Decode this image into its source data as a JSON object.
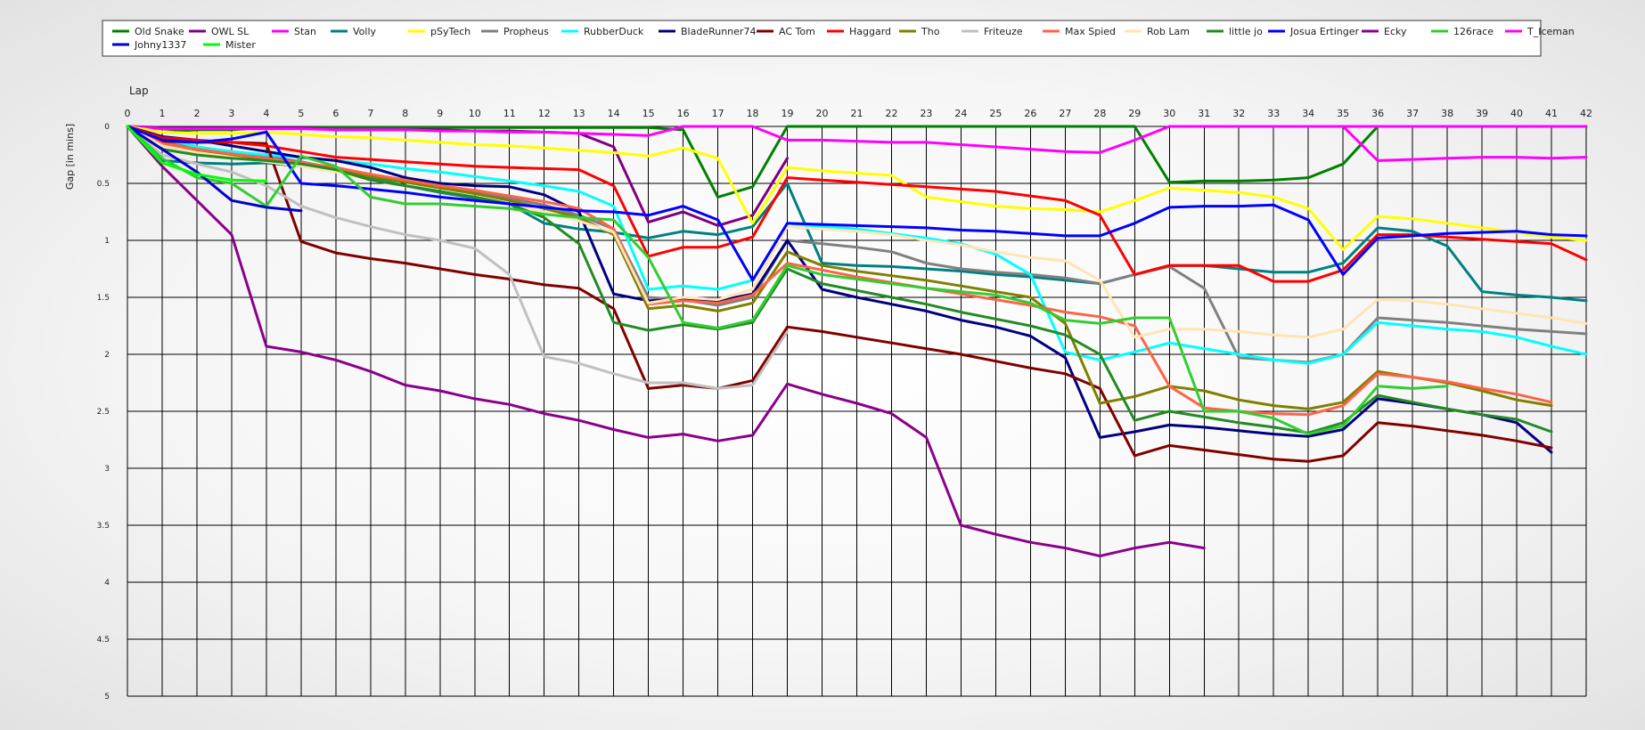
{
  "chart_data": {
    "type": "line",
    "xlabel": "Lap",
    "ylabel": "Gap [in mins]",
    "xlim": [
      0,
      42
    ],
    "ylim": [
      0,
      5
    ],
    "y_inverted": true,
    "grid": true,
    "legend_position": "top",
    "x_ticks": [
      0,
      1,
      2,
      3,
      4,
      5,
      6,
      7,
      8,
      9,
      10,
      11,
      12,
      13,
      14,
      15,
      16,
      17,
      18,
      19,
      20,
      21,
      22,
      23,
      24,
      25,
      26,
      27,
      28,
      29,
      30,
      31,
      32,
      33,
      34,
      35,
      36,
      37,
      38,
      39,
      40,
      41,
      42
    ],
    "y_ticks": [
      "0",
      "0.5",
      "1",
      "1.5",
      "2",
      "2.5",
      "3",
      "3.5",
      "4",
      "4.5",
      "5"
    ],
    "y_tick_values": [
      0,
      0.5,
      1,
      1.5,
      2,
      2.5,
      3,
      3.5,
      4,
      4.5,
      5
    ],
    "series": [
      {
        "name": "Old Snake",
        "color": "#008000",
        "values": [
          0,
          0.05,
          0.03,
          0.03,
          0.01,
          0.01,
          0.01,
          0.01,
          0.01,
          0.01,
          0.01,
          0.01,
          0.01,
          0.01,
          0.01,
          0.01,
          0.03,
          0.62,
          0.53,
          0,
          0,
          0,
          0,
          0,
          0,
          0,
          0,
          0,
          0,
          0,
          0.49,
          0.48,
          0.48,
          0.47,
          0.45,
          0.33,
          0,
          0,
          0,
          0,
          0,
          0,
          0
        ]
      },
      {
        "name": "OWL SL",
        "color": "#800080",
        "values": [
          0,
          0.01,
          0.01,
          0.01,
          0.01,
          0.01,
          0.03,
          0.03,
          0.03,
          0.03,
          0.04,
          0.04,
          0.05,
          0.06,
          0.18,
          0.84,
          0.75,
          0.87,
          0.78,
          0.28,
          null,
          null,
          null,
          null,
          null,
          null,
          null,
          null,
          null,
          null,
          0,
          0,
          0,
          0,
          0,
          0,
          0,
          0,
          0,
          0,
          0,
          0,
          0
        ]
      },
      {
        "name": "Stan",
        "color": "#ff00ff",
        "values": [
          0,
          0.02,
          0.02,
          0.02,
          0.02,
          0.02,
          0.03,
          0.03,
          0.03,
          0.04,
          0.04,
          0.05,
          0.05,
          0.06,
          0.07,
          0.08,
          0,
          0,
          0,
          0.12,
          0.12,
          0.13,
          0.14,
          0.14,
          0.16,
          0.18,
          0.2,
          0.22,
          0.23,
          0.12,
          0,
          0,
          0,
          0,
          0,
          0,
          0,
          0,
          0,
          0,
          0,
          0,
          0
        ]
      },
      {
        "name": "Volly",
        "color": "#008080",
        "values": [
          0,
          0.3,
          0.32,
          0.33,
          0.32,
          0.35,
          0.38,
          0.45,
          0.52,
          0.58,
          0.63,
          0.68,
          0.85,
          0.9,
          0.93,
          0.98,
          0.92,
          0.95,
          0.88,
          0.5,
          1.2,
          1.22,
          1.23,
          1.25,
          1.27,
          1.3,
          1.32,
          1.35,
          1.38,
          1.3,
          1.22,
          1.22,
          1.25,
          1.28,
          1.28,
          1.2,
          0.89,
          0.92,
          1.05,
          1.45,
          1.48,
          1.5,
          1.53
        ]
      },
      {
        "name": "pSyTech",
        "color": "#ffff00",
        "values": [
          0,
          0.05,
          0.06,
          0.06,
          0.05,
          0.07,
          0.09,
          0.1,
          0.12,
          0.14,
          0.16,
          0.17,
          0.19,
          0.21,
          0.23,
          0.26,
          0.19,
          0.28,
          0.85,
          0.36,
          0.39,
          0.41,
          0.43,
          0.62,
          0.66,
          0.7,
          0.72,
          0.73,
          0.75,
          0.65,
          0.54,
          0.56,
          0.58,
          0.62,
          0.72,
          1.08,
          0.79,
          0.81,
          0.85,
          0.89,
          0.93,
          0.97,
          1.0
        ]
      },
      {
        "name": "Propheus",
        "color": "#808080",
        "values": [
          0,
          0.14,
          0.19,
          0.23,
          0.26,
          0.31,
          0.37,
          0.42,
          0.47,
          0.52,
          0.57,
          0.63,
          0.69,
          0.78,
          0.9,
          1.5,
          1.52,
          1.57,
          1.5,
          1.0,
          1.03,
          1.06,
          1.1,
          1.2,
          1.25,
          1.28,
          1.3,
          1.33,
          1.38,
          1.3,
          1.23,
          1.42,
          2.03,
          2.05,
          2.07,
          2.0,
          1.68,
          1.7,
          1.72,
          1.75,
          1.78,
          1.8,
          1.82
        ]
      },
      {
        "name": "RubberDuck",
        "color": "#00ffff",
        "values": [
          0,
          0.1,
          0.18,
          0.22,
          0.25,
          0.27,
          0.3,
          0.33,
          0.37,
          0.4,
          0.44,
          0.48,
          0.52,
          0.57,
          0.7,
          1.43,
          1.4,
          1.43,
          1.35,
          0.85,
          0.88,
          0.9,
          0.94,
          0.98,
          1.03,
          1.12,
          1.3,
          1.98,
          2.05,
          1.98,
          1.9,
          1.95,
          2.0,
          2.05,
          2.08,
          2.0,
          1.72,
          1.75,
          1.78,
          1.8,
          1.85,
          1.93,
          2.0
        ]
      },
      {
        "name": "BladeRunner74",
        "color": "#000080",
        "values": [
          0,
          0.09,
          0.12,
          0.17,
          0.22,
          0.27,
          0.3,
          0.36,
          0.45,
          0.5,
          0.52,
          0.53,
          0.6,
          0.75,
          1.47,
          1.53,
          1.52,
          1.53,
          1.47,
          1.0,
          1.43,
          1.5,
          1.56,
          1.62,
          1.7,
          1.76,
          1.84,
          2.03,
          2.73,
          2.68,
          2.62,
          2.64,
          2.67,
          2.7,
          2.72,
          2.66,
          2.39,
          2.43,
          2.48,
          2.53,
          2.6,
          2.86,
          null
        ]
      },
      {
        "name": "AC Tom",
        "color": "#800000",
        "values": [
          0,
          0.13,
          0.14,
          0.14,
          0.15,
          1.01,
          1.11,
          1.16,
          1.2,
          1.25,
          1.3,
          1.34,
          1.39,
          1.42,
          1.6,
          2.3,
          2.27,
          2.3,
          2.23,
          1.76,
          1.8,
          1.85,
          1.9,
          1.95,
          2.0,
          2.06,
          2.12,
          2.17,
          2.3,
          2.89,
          2.8,
          2.84,
          2.88,
          2.92,
          2.94,
          2.89,
          2.6,
          2.63,
          2.67,
          2.71,
          2.76,
          2.82,
          null
        ]
      },
      {
        "name": "Haggard",
        "color": "#ff0000",
        "values": [
          0,
          0.1,
          0.12,
          0.14,
          0.17,
          0.22,
          0.27,
          0.29,
          0.31,
          0.33,
          0.35,
          0.36,
          0.37,
          0.38,
          0.52,
          1.14,
          1.06,
          1.06,
          0.97,
          0.45,
          0.47,
          0.49,
          0.51,
          0.53,
          0.55,
          0.57,
          0.61,
          0.65,
          0.78,
          1.3,
          1.22,
          1.22,
          1.22,
          1.36,
          1.36,
          1.26,
          0.95,
          0.95,
          0.97,
          0.99,
          1.01,
          1.03,
          1.17
        ]
      },
      {
        "name": "Tho",
        "color": "#808000",
        "values": [
          0,
          0.16,
          0.22,
          0.26,
          0.29,
          0.32,
          0.37,
          0.44,
          0.49,
          0.54,
          0.59,
          0.65,
          0.72,
          0.8,
          0.95,
          1.6,
          1.57,
          1.62,
          1.55,
          1.1,
          1.22,
          1.27,
          1.31,
          1.35,
          1.4,
          1.45,
          1.5,
          1.73,
          2.43,
          2.37,
          2.28,
          2.32,
          2.4,
          2.45,
          2.48,
          2.42,
          2.15,
          2.2,
          2.25,
          2.32,
          2.4,
          2.45,
          null
        ]
      },
      {
        "name": "Friteuze",
        "color": "#c0c0c0",
        "values": [
          0,
          0.25,
          0.33,
          0.4,
          0.52,
          0.7,
          0.8,
          0.88,
          0.95,
          1.0,
          1.07,
          1.3,
          2.02,
          2.08,
          2.17,
          2.25,
          2.25,
          2.3,
          2.27,
          1.8,
          null,
          null,
          null,
          null,
          null,
          null,
          null,
          null,
          null,
          null,
          null,
          null,
          null,
          null,
          null,
          null,
          null,
          null,
          null,
          null,
          null,
          null,
          null
        ]
      },
      {
        "name": "Max Spied",
        "color": "#ff6347",
        "values": [
          0,
          0.15,
          0.2,
          0.24,
          0.28,
          0.32,
          0.36,
          0.42,
          0.47,
          0.52,
          0.56,
          0.61,
          0.66,
          0.72,
          0.9,
          1.56,
          1.53,
          1.55,
          1.48,
          1.2,
          1.26,
          1.32,
          1.37,
          1.42,
          1.47,
          1.52,
          1.57,
          1.63,
          1.67,
          1.75,
          2.28,
          2.47,
          2.5,
          2.52,
          2.53,
          2.45,
          2.17,
          2.2,
          2.24,
          2.3,
          2.35,
          2.42,
          null
        ]
      },
      {
        "name": "Rob Lam",
        "color": "#ffe4b5",
        "values": [
          0,
          0.17,
          0.23,
          0.27,
          0.31,
          0.35,
          0.4,
          0.47,
          0.52,
          0.57,
          0.62,
          0.68,
          0.75,
          0.83,
          0.93,
          1.55,
          1.5,
          1.52,
          1.43,
          0.88,
          0.9,
          0.92,
          0.95,
          1.0,
          1.04,
          1.1,
          1.15,
          1.18,
          1.35,
          1.85,
          1.78,
          1.78,
          1.8,
          1.83,
          1.85,
          1.78,
          1.52,
          1.53,
          1.56,
          1.6,
          1.64,
          1.68,
          1.73
        ]
      },
      {
        "name": "little jo",
        "color": "#228b22",
        "values": [
          0,
          0.2,
          0.25,
          0.28,
          0.3,
          0.33,
          0.38,
          0.47,
          0.52,
          0.57,
          0.62,
          0.68,
          0.8,
          1.03,
          1.72,
          1.79,
          1.74,
          1.78,
          1.72,
          1.25,
          1.38,
          1.44,
          1.5,
          1.56,
          1.63,
          1.69,
          1.75,
          1.83,
          2.0,
          2.58,
          2.5,
          2.55,
          2.6,
          2.64,
          2.69,
          2.6,
          2.36,
          2.42,
          2.48,
          2.53,
          2.57,
          2.68,
          null
        ]
      },
      {
        "name": "Josua Ertinger",
        "color": "#0000ff",
        "values": [
          0,
          0.12,
          0.14,
          0.11,
          0.05,
          0.5,
          0.52,
          0.55,
          0.58,
          0.62,
          0.65,
          0.68,
          0.71,
          0.74,
          0.75,
          0.78,
          0.7,
          0.82,
          1.35,
          0.85,
          0.86,
          0.87,
          0.88,
          0.89,
          0.91,
          0.92,
          0.94,
          0.96,
          0.96,
          0.85,
          0.71,
          0.7,
          0.7,
          0.69,
          0.82,
          1.3,
          0.98,
          0.96,
          0.94,
          0.93,
          0.92,
          0.95,
          0.96
        ]
      },
      {
        "name": "Ecky",
        "color": "#8b008b",
        "values": [
          0,
          0.35,
          0.65,
          0.95,
          1.93,
          1.98,
          2.05,
          2.15,
          2.27,
          2.32,
          2.39,
          2.44,
          2.52,
          2.58,
          2.66,
          2.73,
          2.7,
          2.76,
          2.71,
          2.26,
          2.35,
          2.43,
          2.52,
          2.73,
          3.5,
          3.58,
          3.65,
          3.7,
          3.77,
          3.7,
          3.65,
          3.7,
          null,
          null,
          null,
          null,
          null,
          null,
          null,
          null,
          null,
          null,
          null
        ]
      },
      {
        "name": "126race",
        "color": "#32cd32",
        "values": [
          0,
          0.28,
          0.45,
          0.5,
          0.7,
          0.26,
          0.35,
          0.62,
          0.68,
          0.68,
          0.7,
          0.72,
          0.77,
          0.8,
          0.82,
          1.15,
          1.72,
          1.77,
          1.7,
          1.22,
          1.3,
          1.34,
          1.38,
          1.42,
          1.45,
          1.48,
          1.55,
          1.7,
          1.73,
          1.68,
          1.68,
          2.5,
          2.5,
          2.56,
          2.7,
          2.63,
          2.28,
          2.3,
          2.28,
          null,
          null,
          null,
          null
        ]
      },
      {
        "name": "T_Iceman",
        "color": "#ff00ff",
        "values": [
          null,
          null,
          null,
          null,
          null,
          null,
          null,
          null,
          null,
          null,
          null,
          null,
          null,
          null,
          null,
          null,
          null,
          null,
          null,
          null,
          null,
          null,
          null,
          null,
          null,
          null,
          null,
          null,
          null,
          null,
          null,
          null,
          null,
          null,
          null,
          0,
          0.3,
          0.29,
          0.28,
          0.27,
          0.27,
          0.28,
          0.27
        ]
      },
      {
        "name": "Johny1337",
        "color": "#0000cd",
        "values": [
          0,
          0.2,
          0.4,
          0.65,
          0.71,
          0.74,
          null,
          null,
          null,
          null,
          null,
          null,
          null,
          null,
          null,
          null,
          null,
          null,
          null,
          null,
          null,
          null,
          null,
          null,
          null,
          null,
          null,
          null,
          null,
          null,
          null,
          null,
          null,
          null,
          null,
          null,
          null,
          null,
          null,
          null,
          null,
          null,
          null
        ]
      },
      {
        "name": "Mister",
        "color": "#00ff00",
        "values": [
          0,
          0.32,
          0.42,
          0.47,
          0.48,
          null,
          null,
          null,
          null,
          null,
          null,
          null,
          null,
          null,
          null,
          null,
          null,
          null,
          null,
          null,
          null,
          null,
          null,
          null,
          null,
          null,
          null,
          null,
          null,
          null,
          null,
          null,
          null,
          null,
          null,
          null,
          null,
          null,
          null,
          null,
          null,
          null,
          null
        ]
      }
    ]
  }
}
